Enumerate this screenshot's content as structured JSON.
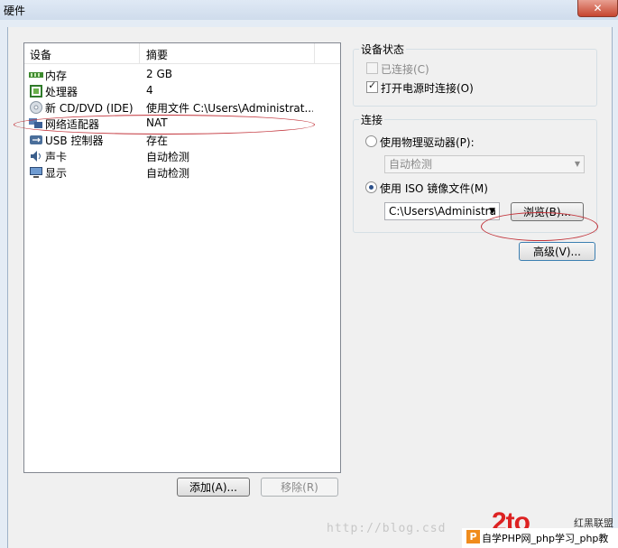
{
  "window": {
    "title": "硬件",
    "close_label": "✕"
  },
  "device_list": {
    "header": {
      "device": "设备",
      "summary": "摘要"
    },
    "rows": [
      {
        "name": "内存",
        "summary": "2 GB",
        "icon": "memory-icon"
      },
      {
        "name": "处理器",
        "summary": "4",
        "icon": "processor-icon"
      },
      {
        "name": "新 CD/DVD (IDE)",
        "summary": "使用文件 C:\\Users\\Administrat...",
        "icon": "cd-dvd-icon"
      },
      {
        "name": "网络适配器",
        "summary": "NAT",
        "icon": "network-adapter-icon"
      },
      {
        "name": "USB 控制器",
        "summary": "存在",
        "icon": "usb-icon"
      },
      {
        "name": "声卡",
        "summary": "自动检测",
        "icon": "sound-card-icon"
      },
      {
        "name": "显示",
        "summary": "自动检测",
        "icon": "display-icon"
      }
    ],
    "add_button": "添加(A)...",
    "remove_button": "移除(R)"
  },
  "device_status": {
    "title": "设备状态",
    "connected_label": "已连接(C)",
    "connected_checked": false,
    "connect_at_power_on_label": "打开电源时连接(O)",
    "connect_at_power_on_checked": true
  },
  "connection": {
    "title": "连接",
    "physical_drive_label": "使用物理驱动器(P):",
    "physical_drive_value": "自动检测",
    "iso_label": "使用 ISO 镜像文件(M)",
    "iso_path": "C:\\Users\\Administra",
    "browse_button": "浏览(B)...",
    "selected": "iso"
  },
  "advanced_button": "高级(V)...",
  "watermark": {
    "url_text": "http://blog.csd",
    "logo_text": "2to",
    "brand_text": "红黑联盟",
    "caption_badge": "P",
    "caption_text": "自学PHP网_php学习_php教"
  },
  "colors": {
    "highlight_ring": "#c2333a",
    "watermark_orange": "#f08c1d"
  }
}
